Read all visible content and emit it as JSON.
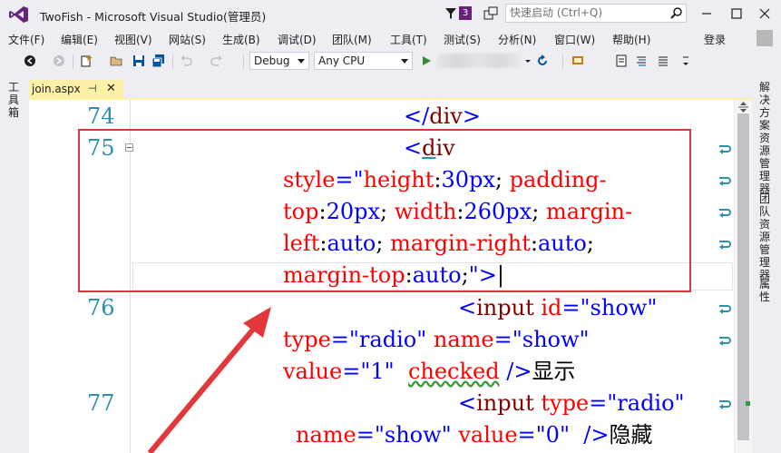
{
  "window": {
    "title": "TwoFish - Microsoft Visual Studio(管理员)",
    "notification_count": "3",
    "quick_launch_placeholder": "快速启动 (Ctrl+Q)"
  },
  "menu": {
    "items": [
      "文件(F)",
      "编辑(E)",
      "视图(V)",
      "网站(S)",
      "生成(B)",
      "调试(D)",
      "团队(M)",
      "工具(T)",
      "测试(S)",
      "分析(N)",
      "窗口(W)",
      "帮助(H)"
    ],
    "login": "登录"
  },
  "toolbar": {
    "config": "Debug",
    "platform": "Any CPU"
  },
  "left_strip": {
    "toolbox": "工具箱"
  },
  "tab": {
    "filename": "join.aspx",
    "pin": "⊣",
    "close": "✕"
  },
  "right_strip": {
    "solution_explorer": "解决方案资源管理器",
    "team_explorer": "团队资源管理器",
    "properties": "属性"
  },
  "editor": {
    "lines": [
      {
        "number": "74",
        "text": "</div>"
      },
      {
        "number": "75",
        "text": "<div style=\"height:30px; padding-top:20px; width:260px; margin-left:auto; margin-right:auto; margin-top:auto;\">"
      },
      {
        "number": "76",
        "text": "<input id=\"show\" type=\"radio\" name=\"show\" value=\"1\"  checked />显示"
      },
      {
        "number": "77",
        "text": "<input type=\"radio\" name=\"show\" value=\"0\"  />隐藏"
      }
    ]
  },
  "colors": {
    "tag": "#800000",
    "attr_name": "#ff0000",
    "attr_value": "#0000ff",
    "line_number": "#2b91af",
    "annotation": "#d8373b",
    "accent": "#68217a"
  }
}
